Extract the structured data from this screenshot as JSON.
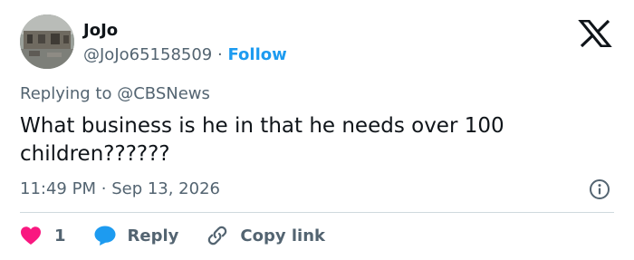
{
  "author": {
    "display_name": "JoJo",
    "handle": "@JoJo65158509",
    "separator": "·",
    "follow_label": "Follow"
  },
  "reply_context": {
    "prefix": "Replying to",
    "mention": "@CBSNews"
  },
  "tweet": {
    "text": "What business is he in that he needs over 100 children??????",
    "time": "11:49 PM",
    "date_separator": "·",
    "date": "Sep 13, 2026"
  },
  "actions": {
    "like_count": "1",
    "reply_label": "Reply",
    "copy_link_label": "Copy link"
  },
  "colors": {
    "accent": "#1d9bf0",
    "like": "#f91880",
    "text": "#0f1419",
    "muted": "#536471",
    "divider": "#cfd9de"
  },
  "icons": [
    "x-logo-icon",
    "info-icon",
    "heart-icon",
    "reply-bubble-icon",
    "link-icon"
  ]
}
